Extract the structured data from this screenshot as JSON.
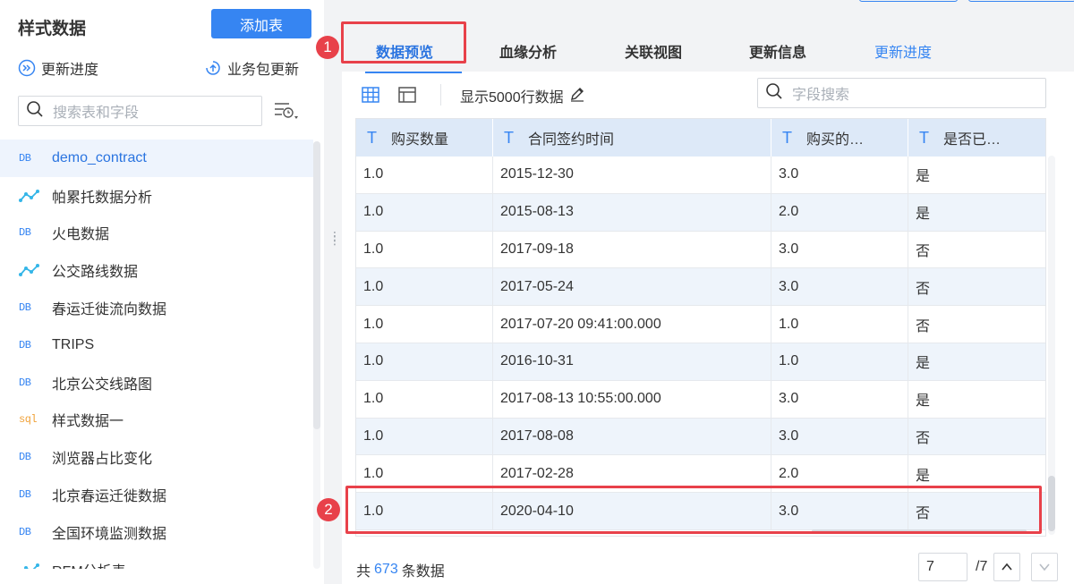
{
  "sidebar": {
    "title": "样式数据",
    "add_button": "添加表",
    "update_progress": "更新进度",
    "package_update": "业务包更新",
    "search_placeholder": "搜索表和字段",
    "items": [
      {
        "tag": "DB",
        "label": "demo_contract",
        "icon": "db-icon"
      },
      {
        "tag": "",
        "label": "帕累托数据分析",
        "icon": "analysis-icon"
      },
      {
        "tag": "DB",
        "label": "火电数据",
        "icon": "db-icon"
      },
      {
        "tag": "",
        "label": "公交路线数据",
        "icon": "analysis-icon"
      },
      {
        "tag": "DB",
        "label": "春运迁徙流向数据",
        "icon": "db-icon"
      },
      {
        "tag": "DB",
        "label": "TRIPS",
        "icon": "db-icon"
      },
      {
        "tag": "DB",
        "label": "北京公交线路图",
        "icon": "db-icon"
      },
      {
        "tag": "sql",
        "label": "样式数据一",
        "icon": "sql-icon"
      },
      {
        "tag": "DB",
        "label": "浏览器占比变化",
        "icon": "db-icon"
      },
      {
        "tag": "DB",
        "label": "北京春运迁徙数据",
        "icon": "db-icon"
      },
      {
        "tag": "DB",
        "label": "全国环境监测数据",
        "icon": "db-icon"
      },
      {
        "tag": "",
        "label": "RFM分析表",
        "icon": "analysis-icon"
      }
    ]
  },
  "tabs": {
    "preview": "数据预览",
    "lineage": "血缘分析",
    "relation": "关联视图",
    "update_info": "更新信息",
    "update_progress": "更新进度"
  },
  "toolbar": {
    "rows_label": "显示5000行数据",
    "search_placeholder": "字段搜索"
  },
  "table": {
    "type_icon": "T",
    "headers": [
      "购买数量",
      "合同签约时间",
      "购买的…",
      "是否已…"
    ],
    "rows": [
      [
        "1.0",
        "2015-12-30",
        "3.0",
        "是"
      ],
      [
        "1.0",
        "2015-08-13",
        "2.0",
        "是"
      ],
      [
        "1.0",
        "2017-09-18",
        "3.0",
        "否"
      ],
      [
        "1.0",
        "2017-05-24",
        "3.0",
        "否"
      ],
      [
        "1.0",
        "2017-07-20 09:41:00.000",
        "1.0",
        "否"
      ],
      [
        "1.0",
        "2016-10-31",
        "1.0",
        "是"
      ],
      [
        "1.0",
        "2017-08-13 10:55:00.000",
        "3.0",
        "是"
      ],
      [
        "1.0",
        "2017-08-08",
        "3.0",
        "否"
      ],
      [
        "1.0",
        "2017-02-28",
        "2.0",
        "是"
      ],
      [
        "1.0",
        "2020-04-10",
        "3.0",
        "否"
      ]
    ]
  },
  "footer": {
    "prefix": "共",
    "count": "673",
    "suffix": "条数据",
    "current_page": "7",
    "total_pages": "/7"
  },
  "annotations": {
    "badge_1": "1",
    "badge_2": "2",
    "color": "#e8414a"
  },
  "colors": {
    "accent": "#3685f2",
    "header_bg": "#dde9f8",
    "row_alt": "#eef4fb"
  }
}
